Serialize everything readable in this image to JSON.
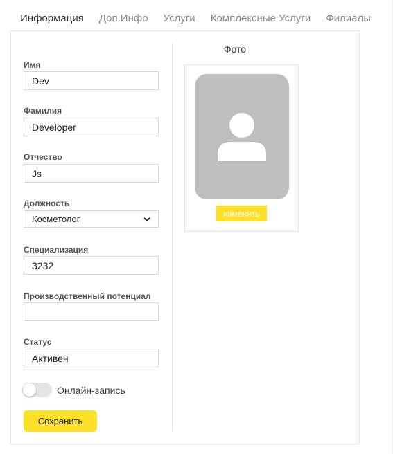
{
  "tabs": [
    {
      "label": "Информация",
      "active": true
    },
    {
      "label": "Доп.Инфо",
      "active": false
    },
    {
      "label": "Услуги",
      "active": false
    },
    {
      "label": "Комплексные Услуги",
      "active": false
    },
    {
      "label": "Филиалы",
      "active": false
    }
  ],
  "form": {
    "first_name": {
      "label": "Имя",
      "value": "Dev"
    },
    "last_name": {
      "label": "Фамилия",
      "value": "Developer"
    },
    "middle_name": {
      "label": "Отчество",
      "value": "Js"
    },
    "position": {
      "label": "Должность",
      "value": "Косметолог"
    },
    "specialization": {
      "label": "Специализация",
      "value": "3232"
    },
    "potential": {
      "label": "Производственный потенциал",
      "value": ""
    },
    "status": {
      "label": "Статус",
      "value": "Активен"
    },
    "online_booking": {
      "label": "Онлайн-запись",
      "enabled": false
    },
    "save_label": "Сохранить"
  },
  "photo": {
    "title": "Фото",
    "change_label": "изменить"
  },
  "colors": {
    "accent": "#fde02a",
    "avatar_bg": "#bebebe"
  }
}
